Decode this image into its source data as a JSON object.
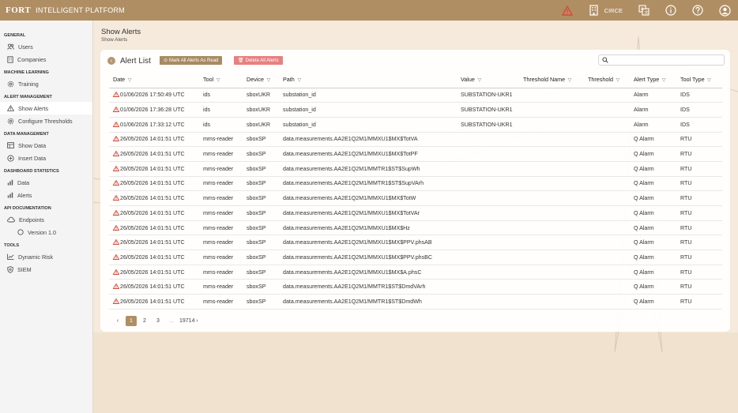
{
  "brand": {
    "logo": "FORT",
    "platform": "INTELLIGENT PLATFORM"
  },
  "topbar": {
    "user": "CIRCE"
  },
  "sidebar": {
    "sections": [
      {
        "title": "GENERAL",
        "items": [
          {
            "label": "Users",
            "icon": "users-icon"
          },
          {
            "label": "Companies",
            "icon": "building-icon"
          }
        ]
      },
      {
        "title": "MACHINE LEARNING",
        "items": [
          {
            "label": "Training",
            "icon": "gear-icon"
          }
        ]
      },
      {
        "title": "ALERT MANAGEMENT",
        "items": [
          {
            "label": "Show Alerts",
            "icon": "warning-icon",
            "active": true
          },
          {
            "label": "Configure Thresholds",
            "icon": "gear-icon"
          }
        ]
      },
      {
        "title": "DATA MANAGEMENT",
        "items": [
          {
            "label": "Show Data",
            "icon": "table-icon"
          },
          {
            "label": "Insert Data",
            "icon": "plus-circle-icon"
          }
        ]
      },
      {
        "title": "DASHBOARD STATISTICS",
        "items": [
          {
            "label": "Data",
            "icon": "bar-chart-icon"
          },
          {
            "label": "Alerts",
            "icon": "bar-chart-icon"
          }
        ]
      },
      {
        "title": "API DOCUMENTATION",
        "items": [
          {
            "label": "Endpoints",
            "icon": "cloud-icon"
          },
          {
            "label": "Version 1.0",
            "icon": "circle-icon",
            "sub": true
          }
        ]
      },
      {
        "title": "TOOLS",
        "items": [
          {
            "label": "Dynamic Risk",
            "icon": "line-chart-icon"
          },
          {
            "label": "SIEM",
            "icon": "shield-icon"
          }
        ]
      }
    ]
  },
  "page": {
    "title": "Show Alerts",
    "breadcrumb": "Show Alerts"
  },
  "card": {
    "back_icon": "‹",
    "title": "Alert List",
    "mark_all_label": "Mark All Alerts As Read",
    "delete_all_label": "Delete All Alerts",
    "search_placeholder": ""
  },
  "table": {
    "headers": [
      "Date",
      "Tool",
      "Device",
      "Path",
      "Value",
      "Threshold Name",
      "Threshold",
      "Alert Type",
      "Tool Type"
    ],
    "rows": [
      [
        "01/06/2026 17:50:49 UTC",
        "ids",
        "sboxUKR",
        "substation_id",
        "SUBSTATION-UKR1",
        "",
        "",
        "Alarm",
        "IDS"
      ],
      [
        "01/06/2026 17:36:28 UTC",
        "ids",
        "sboxUKR",
        "substation_id",
        "SUBSTATION-UKR1",
        "",
        "",
        "Alarm",
        "IDS"
      ],
      [
        "01/06/2026 17:33:12 UTC",
        "ids",
        "sboxUKR",
        "substation_id",
        "SUBSTATION-UKR1",
        "",
        "",
        "Alarm",
        "IDS"
      ],
      [
        "26/05/2026 14:01:51 UTC",
        "mms-reader",
        "sboxSP",
        "data.measurements.AA2E1Q2M1/MMXU1$MX$TotVA",
        "",
        "",
        "",
        "Q Alarm",
        "RTU"
      ],
      [
        "26/05/2026 14:01:51 UTC",
        "mms-reader",
        "sboxSP",
        "data.measurements.AA2E1Q2M1/MMXU1$MX$TotPF",
        "",
        "",
        "",
        "Q Alarm",
        "RTU"
      ],
      [
        "26/05/2026 14:01:51 UTC",
        "mms-reader",
        "sboxSP",
        "data.measurements.AA2E1Q2M1/MMTR1$ST$SupWh",
        "",
        "",
        "",
        "Q Alarm",
        "RTU"
      ],
      [
        "26/05/2026 14:01:51 UTC",
        "mms-reader",
        "sboxSP",
        "data.measurements.AA2E1Q2M1/MMTR1$ST$SupVArh",
        "",
        "",
        "",
        "Q Alarm",
        "RTU"
      ],
      [
        "26/05/2026 14:01:51 UTC",
        "mms-reader",
        "sboxSP",
        "data.measurements.AA2E1Q2M1/MMXU1$MX$TotW",
        "",
        "",
        "",
        "Q Alarm",
        "RTU"
      ],
      [
        "26/05/2026 14:01:51 UTC",
        "mms-reader",
        "sboxSP",
        "data.measurements.AA2E1Q2M1/MMXU1$MX$TotVAr",
        "",
        "",
        "",
        "Q Alarm",
        "RTU"
      ],
      [
        "26/05/2026 14:01:51 UTC",
        "mms-reader",
        "sboxSP",
        "data.measurements.AA2E1Q2M1/MMXU1$MX$Hz",
        "",
        "",
        "",
        "Q Alarm",
        "RTU"
      ],
      [
        "26/05/2026 14:01:51 UTC",
        "mms-reader",
        "sboxSP",
        "data.measurements.AA2E1Q2M1/MMXU1$MX$PPV.phsAB",
        "",
        "",
        "",
        "Q Alarm",
        "RTU"
      ],
      [
        "26/05/2026 14:01:51 UTC",
        "mms-reader",
        "sboxSP",
        "data.measurements.AA2E1Q2M1/MMXU1$MX$PPV.phsBC",
        "",
        "",
        "",
        "Q Alarm",
        "RTU"
      ],
      [
        "26/05/2026 14:01:51 UTC",
        "mms-reader",
        "sboxSP",
        "data.measurements.AA2E1Q2M1/MMXU1$MX$A.phsC",
        "",
        "",
        "",
        "Q Alarm",
        "RTU"
      ],
      [
        "26/05/2026 14:01:51 UTC",
        "mms-reader",
        "sboxSP",
        "data.measurements.AA2E1Q2M1/MMTR1$ST$DmdVArh",
        "",
        "",
        "",
        "Q Alarm",
        "RTU"
      ],
      [
        "26/05/2026 14:01:51 UTC",
        "mms-reader",
        "sboxSP",
        "data.measurements.AA2E1Q2M1/MMTR1$ST$DmdWh",
        "",
        "",
        "",
        "Q Alarm",
        "RTU"
      ]
    ]
  },
  "pager": {
    "prev": "‹",
    "pages": [
      "1",
      "2",
      "3"
    ],
    "dots": "...",
    "last": "19714",
    "next": "›"
  },
  "colors": {
    "accent": "#b08e63",
    "danger": "#e88080",
    "warning": "#d94a3a"
  }
}
